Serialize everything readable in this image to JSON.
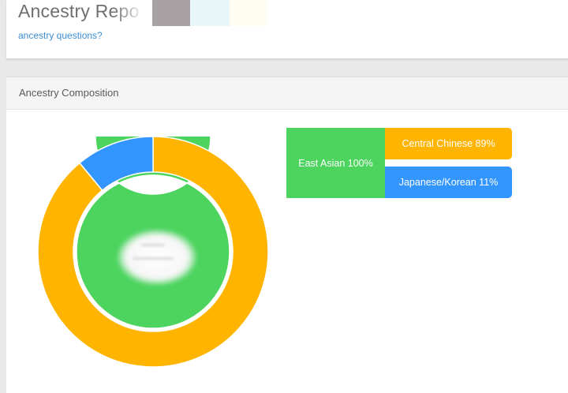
{
  "header": {
    "title": "Ancestry Repo",
    "link": "ancestry questions?"
  },
  "panel": {
    "title": "Ancestry Composition"
  },
  "colors": {
    "east_asian": "#4cd45e",
    "central_chinese": "#ffb400",
    "japanese_korean": "#3396fe",
    "center_ring": "#7da37f"
  },
  "chart_data": {
    "type": "pie",
    "levels": [
      {
        "slices": [
          {
            "label": "East Asian",
            "value": 100,
            "color": "#4cd45e"
          }
        ]
      },
      {
        "slices": [
          {
            "label": "Central Chinese",
            "value": 89,
            "color": "#ffb400"
          },
          {
            "label": "Japanese/Korean",
            "value": 11,
            "color": "#3396fe"
          }
        ]
      }
    ]
  },
  "legend": {
    "parent": {
      "label": "East Asian 100%",
      "color": "#4cd45e"
    },
    "children": [
      {
        "label": "Central Chinese 89%",
        "color": "#ffb400"
      },
      {
        "label": "Japanese/Korean 11%",
        "color": "#3396fe"
      }
    ]
  }
}
